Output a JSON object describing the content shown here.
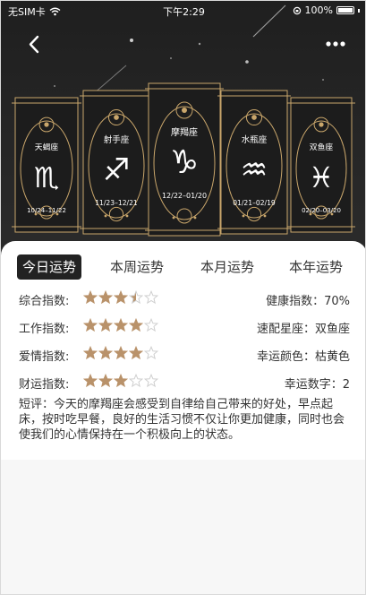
{
  "status": {
    "carrier": "无SIM卡",
    "time": "下午2:29",
    "battery": "100%"
  },
  "zodiac_cards": [
    {
      "name": "天蝎座",
      "glyph": "♏",
      "dates": "10/24–11/22"
    },
    {
      "name": "射手座",
      "glyph": "♐",
      "dates": "11/23–12/21"
    },
    {
      "name": "摩羯座",
      "glyph": "♑",
      "dates": "12/22–01/20"
    },
    {
      "name": "水瓶座",
      "glyph": "♒",
      "dates": "01/21–02/19"
    },
    {
      "name": "双鱼座",
      "glyph": "♓",
      "dates": "02/20–03/20"
    }
  ],
  "tabs": [
    {
      "label": "今日运势",
      "active": true
    },
    {
      "label": "本周运势",
      "active": false
    },
    {
      "label": "本月运势",
      "active": false
    },
    {
      "label": "本年运势",
      "active": false
    }
  ],
  "indices": [
    {
      "label": "综合指数:",
      "stars": 3.5,
      "right": "健康指数：70%"
    },
    {
      "label": "工作指数:",
      "stars": 4,
      "right": "速配星座：双鱼座"
    },
    {
      "label": "爱情指数:",
      "stars": 4,
      "right": "幸运颜色：枯黄色"
    },
    {
      "label": "财运指数:",
      "stars": 3,
      "right": "幸运数字：2"
    }
  ],
  "comment": "短评：今天的摩羯座会感受到自律给自己带来的好处，早点起床，按时吃早餐，良好的生活习惯不仅让你更加健康，同时也会使我们的心情保持在一个积极向上的状态。",
  "colors": {
    "gold": "#c9a66b",
    "star_fill": "#b9926a",
    "star_empty": "#cfcfcf",
    "hero_bg": "#232323"
  },
  "icons": {
    "back": "chevron-left-icon",
    "more": "more-horizontal-icon",
    "wifi": "wifi-icon"
  }
}
